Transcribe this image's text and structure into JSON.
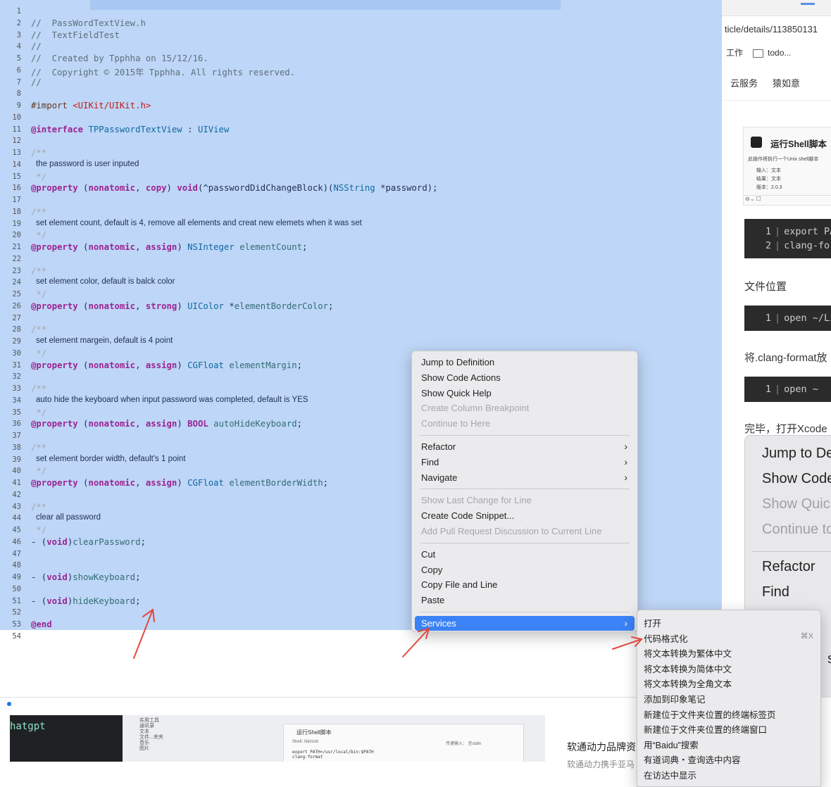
{
  "editor": {
    "line_numbers": [
      "1",
      "2",
      "3",
      "4",
      "5",
      "6",
      "7",
      "8",
      "9",
      "10",
      "11",
      "12",
      "13",
      "14",
      "15",
      "16",
      "17",
      "18",
      "19",
      "20",
      "21",
      "22",
      "23",
      "24",
      "25",
      "26",
      "27",
      "28",
      "29",
      "30",
      "31",
      "32",
      "33",
      "34",
      "35",
      "36",
      "37",
      "38",
      "39",
      "40",
      "41",
      "42",
      "43",
      "44",
      "45",
      "46",
      "47",
      "48",
      "49",
      "50",
      "51",
      "52",
      "53",
      "54"
    ],
    "lines": [
      {
        "n": 2,
        "kind": "code",
        "tokens": [
          {
            "c": "comment",
            "t": "//  PassWordTextView.h"
          }
        ]
      },
      {
        "n": 3,
        "kind": "code",
        "tokens": [
          {
            "c": "comment",
            "t": "//  TextFieldTest"
          }
        ]
      },
      {
        "n": 4,
        "kind": "code",
        "tokens": [
          {
            "c": "comment",
            "t": "//"
          }
        ]
      },
      {
        "n": 5,
        "kind": "code",
        "tokens": [
          {
            "c": "comment",
            "t": "//  Created by Tpphha on 15/12/16."
          }
        ]
      },
      {
        "n": 6,
        "kind": "code",
        "tokens": [
          {
            "c": "comment",
            "t": "//  Copyright © 2015年 Tpphha. All rights reserved."
          }
        ]
      },
      {
        "n": 7,
        "kind": "code",
        "tokens": [
          {
            "c": "comment",
            "t": "//"
          }
        ]
      },
      {
        "n": 9,
        "kind": "code",
        "tokens": [
          {
            "c": "directive",
            "t": "#import "
          },
          {
            "c": "string",
            "t": "<UIKit/UIKit.h>"
          }
        ]
      },
      {
        "n": 11,
        "kind": "code",
        "tokens": [
          {
            "c": "keyword",
            "t": "@interface"
          },
          {
            "c": "plain",
            "t": " "
          },
          {
            "c": "type",
            "t": "TPPasswordTextView"
          },
          {
            "c": "plain",
            "t": " : "
          },
          {
            "c": "type",
            "t": "UIView"
          }
        ]
      },
      {
        "n": 13,
        "kind": "code",
        "tokens": [
          {
            "c": "docmark",
            "t": "/**"
          }
        ]
      },
      {
        "n": 14,
        "kind": "doc",
        "tokens": [
          {
            "c": "plain",
            "t": "the password is user inputed"
          }
        ]
      },
      {
        "n": 15,
        "kind": "code",
        "tokens": [
          {
            "c": "docmark",
            "t": " */"
          }
        ]
      },
      {
        "n": 16,
        "kind": "code",
        "tokens": [
          {
            "c": "keyword",
            "t": "@property"
          },
          {
            "c": "plain",
            "t": " ("
          },
          {
            "c": "keyword",
            "t": "nonatomic"
          },
          {
            "c": "plain",
            "t": ", "
          },
          {
            "c": "keyword",
            "t": "copy"
          },
          {
            "c": "plain",
            "t": ") "
          },
          {
            "c": "keyword",
            "t": "void"
          },
          {
            "c": "plain",
            "t": "(^passwordDidChangeBlock)("
          },
          {
            "c": "type",
            "t": "NSString"
          },
          {
            "c": "plain",
            "t": " *password);"
          }
        ]
      },
      {
        "n": 18,
        "kind": "code",
        "tokens": [
          {
            "c": "docmark",
            "t": "/**"
          }
        ]
      },
      {
        "n": 19,
        "kind": "doc",
        "tokens": [
          {
            "c": "plain",
            "t": "set element count, default is 4, remove all elements and creat new elemets when it was set"
          }
        ]
      },
      {
        "n": 20,
        "kind": "code",
        "tokens": [
          {
            "c": "docmark",
            "t": " */"
          }
        ]
      },
      {
        "n": 21,
        "kind": "code",
        "tokens": [
          {
            "c": "keyword",
            "t": "@property"
          },
          {
            "c": "plain",
            "t": " ("
          },
          {
            "c": "keyword",
            "t": "nonatomic"
          },
          {
            "c": "plain",
            "t": ", "
          },
          {
            "c": "keyword",
            "t": "assign"
          },
          {
            "c": "plain",
            "t": ") "
          },
          {
            "c": "type",
            "t": "NSInteger"
          },
          {
            "c": "plain",
            "t": " "
          },
          {
            "c": "prop",
            "t": "elementCount"
          },
          {
            "c": "plain",
            "t": ";"
          }
        ]
      },
      {
        "n": 23,
        "kind": "code",
        "tokens": [
          {
            "c": "docmark",
            "t": "/**"
          }
        ]
      },
      {
        "n": 24,
        "kind": "doc",
        "tokens": [
          {
            "c": "plain",
            "t": "set element color, default is balck color"
          }
        ]
      },
      {
        "n": 25,
        "kind": "code",
        "tokens": [
          {
            "c": "docmark",
            "t": " */"
          }
        ]
      },
      {
        "n": 26,
        "kind": "code",
        "tokens": [
          {
            "c": "keyword",
            "t": "@property"
          },
          {
            "c": "plain",
            "t": " ("
          },
          {
            "c": "keyword",
            "t": "nonatomic"
          },
          {
            "c": "plain",
            "t": ", "
          },
          {
            "c": "keyword",
            "t": "strong"
          },
          {
            "c": "plain",
            "t": ") "
          },
          {
            "c": "type",
            "t": "UIColor"
          },
          {
            "c": "plain",
            "t": " *"
          },
          {
            "c": "prop",
            "t": "elementBorderColor"
          },
          {
            "c": "plain",
            "t": ";"
          }
        ]
      },
      {
        "n": 28,
        "kind": "code",
        "tokens": [
          {
            "c": "docmark",
            "t": "/**"
          }
        ]
      },
      {
        "n": 29,
        "kind": "doc",
        "tokens": [
          {
            "c": "plain",
            "t": "set element margein, default is 4 point"
          }
        ]
      },
      {
        "n": 30,
        "kind": "code",
        "tokens": [
          {
            "c": "docmark",
            "t": " */"
          }
        ]
      },
      {
        "n": 31,
        "kind": "code",
        "tokens": [
          {
            "c": "keyword",
            "t": "@property"
          },
          {
            "c": "plain",
            "t": " ("
          },
          {
            "c": "keyword",
            "t": "nonatomic"
          },
          {
            "c": "plain",
            "t": ", "
          },
          {
            "c": "keyword",
            "t": "assign"
          },
          {
            "c": "plain",
            "t": ") "
          },
          {
            "c": "type",
            "t": "CGFloat"
          },
          {
            "c": "plain",
            "t": " "
          },
          {
            "c": "prop",
            "t": "elementMargin"
          },
          {
            "c": "plain",
            "t": ";"
          }
        ]
      },
      {
        "n": 33,
        "kind": "code",
        "tokens": [
          {
            "c": "docmark",
            "t": "/**"
          }
        ]
      },
      {
        "n": 34,
        "kind": "doc",
        "tokens": [
          {
            "c": "plain",
            "t": "auto hide the keyboard when input password was completed, default is YES"
          }
        ]
      },
      {
        "n": 35,
        "kind": "code",
        "tokens": [
          {
            "c": "docmark",
            "t": " */"
          }
        ]
      },
      {
        "n": 36,
        "kind": "code",
        "tokens": [
          {
            "c": "keyword",
            "t": "@property"
          },
          {
            "c": "plain",
            "t": " ("
          },
          {
            "c": "keyword",
            "t": "nonatomic"
          },
          {
            "c": "plain",
            "t": ", "
          },
          {
            "c": "keyword",
            "t": "assign"
          },
          {
            "c": "plain",
            "t": ") "
          },
          {
            "c": "keyword",
            "t": "BOOL"
          },
          {
            "c": "plain",
            "t": " "
          },
          {
            "c": "prop",
            "t": "autoHideKeyboard"
          },
          {
            "c": "plain",
            "t": ";"
          }
        ]
      },
      {
        "n": 38,
        "kind": "code",
        "tokens": [
          {
            "c": "docmark",
            "t": "/**"
          }
        ]
      },
      {
        "n": 39,
        "kind": "doc",
        "tokens": [
          {
            "c": "plain",
            "t": "set element border width, default's 1 point"
          }
        ]
      },
      {
        "n": 40,
        "kind": "code",
        "tokens": [
          {
            "c": "docmark",
            "t": " */"
          }
        ]
      },
      {
        "n": 41,
        "kind": "code",
        "tokens": [
          {
            "c": "keyword",
            "t": "@property"
          },
          {
            "c": "plain",
            "t": " ("
          },
          {
            "c": "keyword",
            "t": "nonatomic"
          },
          {
            "c": "plain",
            "t": ", "
          },
          {
            "c": "keyword",
            "t": "assign"
          },
          {
            "c": "plain",
            "t": ") "
          },
          {
            "c": "type",
            "t": "CGFloat"
          },
          {
            "c": "plain",
            "t": " "
          },
          {
            "c": "prop",
            "t": "elementBorderWidth"
          },
          {
            "c": "plain",
            "t": ";"
          }
        ]
      },
      {
        "n": 43,
        "kind": "code",
        "tokens": [
          {
            "c": "docmark",
            "t": "/**"
          }
        ]
      },
      {
        "n": 44,
        "kind": "doc",
        "tokens": [
          {
            "c": "plain",
            "t": "clear all password"
          }
        ]
      },
      {
        "n": 45,
        "kind": "code",
        "tokens": [
          {
            "c": "docmark",
            "t": " */"
          }
        ]
      },
      {
        "n": 46,
        "kind": "code",
        "tokens": [
          {
            "c": "plain",
            "t": "- ("
          },
          {
            "c": "keyword",
            "t": "void"
          },
          {
            "c": "plain",
            "t": ")"
          },
          {
            "c": "prop",
            "t": "clearPassword"
          },
          {
            "c": "plain",
            "t": ";"
          }
        ]
      },
      {
        "n": 49,
        "kind": "code",
        "tokens": [
          {
            "c": "plain",
            "t": "- ("
          },
          {
            "c": "keyword",
            "t": "void"
          },
          {
            "c": "plain",
            "t": ")"
          },
          {
            "c": "prop",
            "t": "showKeyboard"
          },
          {
            "c": "plain",
            "t": ";"
          }
        ]
      },
      {
        "n": 51,
        "kind": "code",
        "tokens": [
          {
            "c": "plain",
            "t": "- ("
          },
          {
            "c": "keyword",
            "t": "void"
          },
          {
            "c": "plain",
            "t": ")"
          },
          {
            "c": "prop",
            "t": "hideKeyboard"
          },
          {
            "c": "plain",
            "t": ";"
          }
        ]
      },
      {
        "n": 53,
        "kind": "code",
        "tokens": [
          {
            "c": "keyword",
            "t": "@end"
          }
        ]
      }
    ]
  },
  "context_menu": {
    "items": [
      {
        "label": "Jump to Definition",
        "enabled": true
      },
      {
        "label": "Show Code Actions",
        "enabled": true
      },
      {
        "label": "Show Quick Help",
        "enabled": true
      },
      {
        "label": "Create Column Breakpoint",
        "enabled": false
      },
      {
        "label": "Continue to Here",
        "enabled": false
      },
      {
        "sep": true
      },
      {
        "label": "Refactor",
        "enabled": true,
        "submenu": true
      },
      {
        "label": "Find",
        "enabled": true,
        "submenu": true
      },
      {
        "label": "Navigate",
        "enabled": true,
        "submenu": true
      },
      {
        "sep": true
      },
      {
        "label": "Show Last Change for Line",
        "enabled": false
      },
      {
        "label": "Create Code Snippet...",
        "enabled": true
      },
      {
        "label": "Add Pull Request Discussion to Current Line",
        "enabled": false
      },
      {
        "sep": true
      },
      {
        "label": "Cut",
        "enabled": true
      },
      {
        "label": "Copy",
        "enabled": true
      },
      {
        "label": "Copy File and Line",
        "enabled": true
      },
      {
        "label": "Paste",
        "enabled": true
      },
      {
        "sep": true
      },
      {
        "label": "Services",
        "enabled": true,
        "submenu": true,
        "highlighted": true
      }
    ],
    "chevron": "›"
  },
  "services_menu": {
    "items": [
      {
        "label": "打开",
        "shortcut": ""
      },
      {
        "label": "代码格式化",
        "shortcut": "⌘X"
      },
      {
        "label": "将文本转换为繁体中文",
        "shortcut": ""
      },
      {
        "label": "将文本转换为简体中文",
        "shortcut": ""
      },
      {
        "label": "将文本转换为全角文本",
        "shortcut": ""
      },
      {
        "label": "添加到印象笔记",
        "shortcut": ""
      },
      {
        "label": "新建位于文件夹位置的终端标签页",
        "shortcut": ""
      },
      {
        "label": "新建位于文件夹位置的终端窗口",
        "shortcut": ""
      },
      {
        "label": "用“Baidu”搜索",
        "shortcut": ""
      },
      {
        "label": "有道词典・查询选中内容",
        "shortcut": ""
      },
      {
        "label": "在访达中显示",
        "shortcut": ""
      }
    ]
  },
  "browser": {
    "url_fragment": "ticle/details/113850131",
    "bookmarks": {
      "first": "工作",
      "second": "todo..."
    },
    "nav": {
      "item1": "云服务",
      "item2": "猿如意"
    },
    "shell_card": {
      "title": "运行Shell脚本",
      "desc": "此操作将执行一个Unix shell脚本",
      "input": "输入：文本",
      "result": "结果：文本",
      "version": "版本：2.0.3"
    },
    "code_block_1": [
      {
        "n": "1",
        "t": "export PATH"
      },
      {
        "n": "2",
        "t": "clang-format"
      }
    ],
    "file_location_heading": "文件位置",
    "code_block_2": [
      {
        "n": "1",
        "t": "open ~/Library"
      }
    ],
    "put_clang_text": "将.clang-format放",
    "code_block_3": [
      {
        "n": "1",
        "t": "open ~"
      }
    ],
    "finish_text": "完毕，打开Xcode",
    "mini_menu": {
      "items": [
        {
          "label": "Jump to Definition",
          "dim": false
        },
        {
          "label": "Show Code Actions",
          "dim": false
        },
        {
          "label": "Show Quick Help",
          "dim": true
        },
        {
          "label": "Continue to Here",
          "dim": true
        },
        {
          "sep": true
        },
        {
          "label": "Refactor",
          "dim": false
        },
        {
          "label": "Find",
          "dim": false
        }
      ]
    },
    "side_fragments": [
      "s",
      "关"
    ]
  },
  "bottom": {
    "terminal_text": "hatgpt",
    "finder_side": [
      "实用工具",
      "通讯录",
      "文本",
      "文件...夹夹",
      "音乐",
      "图片"
    ],
    "finder_title": "运行Shell脚本",
    "finder_shell": "Shell: /bin/zsh",
    "finder_input": "传递输入： 至stdin",
    "finder_code": "export PATH=/usr/local/bin:$PATH\nclang-format",
    "ad_title": "软通动力品牌资",
    "ad_sub": "软通动力携手亚马"
  }
}
